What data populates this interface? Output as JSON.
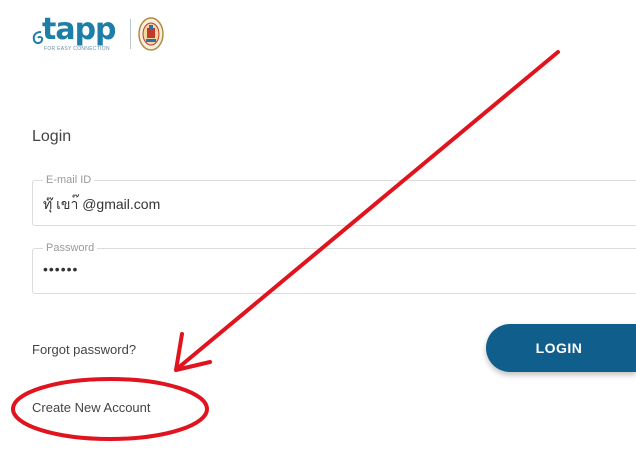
{
  "brand": {
    "logo_text": "tapp",
    "tagline": "FOR EASY CONNECTION"
  },
  "login": {
    "heading": "Login",
    "email": {
      "legend": "E-mail ID",
      "value": "ทุ๊ เขา๊ @gmail.com"
    },
    "password": {
      "legend": "Password",
      "value": "••••••"
    },
    "forgot_label": "Forgot password?",
    "login_label": "LOGIN",
    "create_label": "Create New Account"
  },
  "annotation": {
    "color": "#e0141e"
  }
}
